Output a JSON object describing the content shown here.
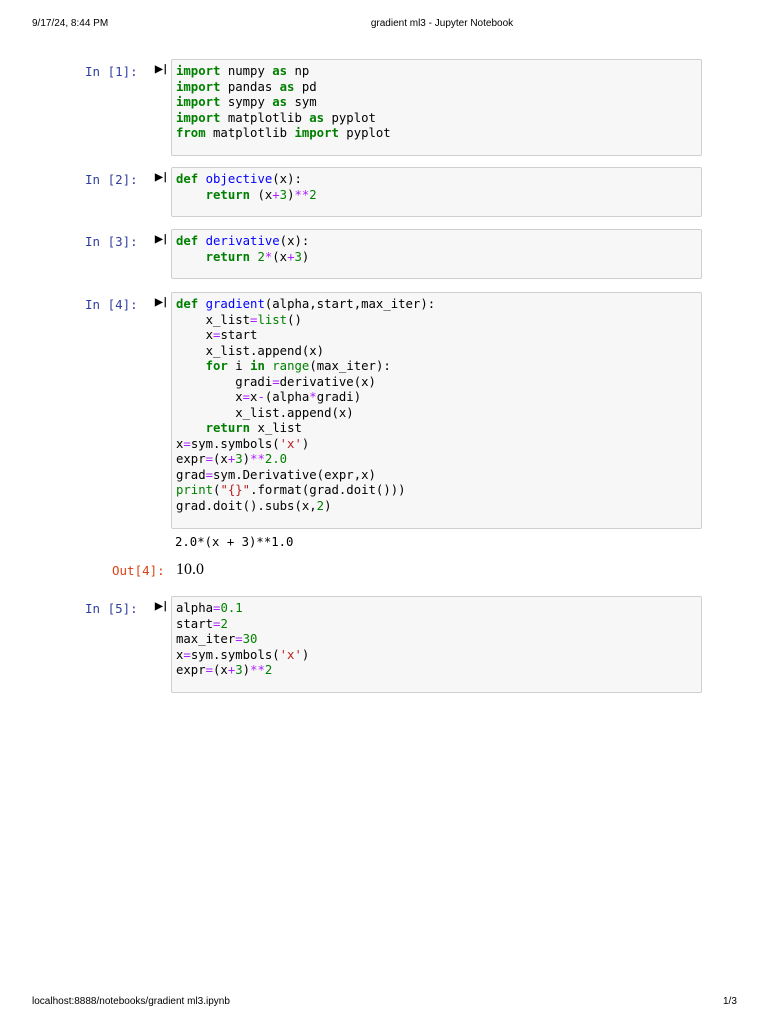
{
  "header": {
    "datetime": "9/17/24, 8:44 PM",
    "title": "gradient ml3 - Jupyter Notebook"
  },
  "footer": {
    "url": "localhost:8888/notebooks/gradient ml3.ipynb",
    "page": "1/3"
  },
  "cells": [
    {
      "prompt": "In [1]:",
      "lines": [
        [
          [
            "k",
            "import"
          ],
          [
            "p",
            " numpy "
          ],
          [
            "k",
            "as"
          ],
          [
            "p",
            " np"
          ]
        ],
        [
          [
            "k",
            "import"
          ],
          [
            "p",
            " pandas "
          ],
          [
            "k",
            "as"
          ],
          [
            "p",
            " pd"
          ]
        ],
        [
          [
            "k",
            "import"
          ],
          [
            "p",
            " sympy "
          ],
          [
            "k",
            "as"
          ],
          [
            "p",
            " sym"
          ]
        ],
        [
          [
            "k",
            "import"
          ],
          [
            "p",
            " matplotlib "
          ],
          [
            "k",
            "as"
          ],
          [
            "p",
            " pyplot"
          ]
        ],
        [
          [
            "k",
            "from"
          ],
          [
            "p",
            " matplotlib "
          ],
          [
            "k",
            "import"
          ],
          [
            "p",
            " pyplot"
          ]
        ]
      ]
    },
    {
      "prompt": "In [2]:",
      "lines": [
        [
          [
            "k",
            "def"
          ],
          [
            "p",
            " "
          ],
          [
            "f",
            "objective"
          ],
          [
            "p",
            "(x):"
          ]
        ],
        [
          [
            "p",
            "    "
          ],
          [
            "k",
            "return"
          ],
          [
            "p",
            " (x"
          ],
          [
            "o",
            "+"
          ],
          [
            "n",
            "3"
          ],
          [
            "p",
            ")"
          ],
          [
            "o",
            "**"
          ],
          [
            "n",
            "2"
          ]
        ]
      ]
    },
    {
      "prompt": "In [3]:",
      "lines": [
        [
          [
            "k",
            "def"
          ],
          [
            "p",
            " "
          ],
          [
            "f",
            "derivative"
          ],
          [
            "p",
            "(x):"
          ]
        ],
        [
          [
            "p",
            "    "
          ],
          [
            "k",
            "return"
          ],
          [
            "p",
            " "
          ],
          [
            "n",
            "2"
          ],
          [
            "o",
            "*"
          ],
          [
            "p",
            "(x"
          ],
          [
            "o",
            "+"
          ],
          [
            "n",
            "3"
          ],
          [
            "p",
            ")"
          ]
        ]
      ]
    },
    {
      "prompt": "In [4]:",
      "lines": [
        [
          [
            "k",
            "def"
          ],
          [
            "p",
            " "
          ],
          [
            "f",
            "gradient"
          ],
          [
            "p",
            "(alpha,start,max_iter):"
          ]
        ],
        [
          [
            "p",
            "    x_list"
          ],
          [
            "o",
            "="
          ],
          [
            "b",
            "list"
          ],
          [
            "p",
            "()"
          ]
        ],
        [
          [
            "p",
            "    x"
          ],
          [
            "o",
            "="
          ],
          [
            "p",
            "start"
          ]
        ],
        [
          [
            "p",
            "    x_list.append(x)"
          ]
        ],
        [
          [
            "p",
            "    "
          ],
          [
            "k",
            "for"
          ],
          [
            "p",
            " i "
          ],
          [
            "k",
            "in"
          ],
          [
            "p",
            " "
          ],
          [
            "b",
            "range"
          ],
          [
            "p",
            "(max_iter):"
          ]
        ],
        [
          [
            "p",
            "        gradi"
          ],
          [
            "o",
            "="
          ],
          [
            "p",
            "derivative(x)"
          ]
        ],
        [
          [
            "p",
            "        x"
          ],
          [
            "o",
            "="
          ],
          [
            "p",
            "x"
          ],
          [
            "o",
            "-"
          ],
          [
            "p",
            "(alpha"
          ],
          [
            "o",
            "*"
          ],
          [
            "p",
            "gradi)"
          ]
        ],
        [
          [
            "p",
            "        x_list.append(x)"
          ]
        ],
        [
          [
            "p",
            "    "
          ],
          [
            "k",
            "return"
          ],
          [
            "p",
            " x_list"
          ]
        ],
        [
          [
            "p",
            "x"
          ],
          [
            "o",
            "="
          ],
          [
            "p",
            "sym.symbols("
          ],
          [
            "s",
            "'x'"
          ],
          [
            "p",
            ")"
          ]
        ],
        [
          [
            "p",
            "expr"
          ],
          [
            "o",
            "="
          ],
          [
            "p",
            "(x"
          ],
          [
            "o",
            "+"
          ],
          [
            "n",
            "3"
          ],
          [
            "p",
            ")"
          ],
          [
            "o",
            "**"
          ],
          [
            "n",
            "2.0"
          ]
        ],
        [
          [
            "p",
            "grad"
          ],
          [
            "o",
            "="
          ],
          [
            "p",
            "sym.Derivative(expr,x)"
          ]
        ],
        [
          [
            "b",
            "print"
          ],
          [
            "p",
            "("
          ],
          [
            "s",
            "\"{}\""
          ],
          [
            "p",
            ".format(grad.doit()))"
          ]
        ],
        [
          [
            "p",
            "grad.doit().subs(x,"
          ],
          [
            "n",
            "2"
          ],
          [
            "p",
            ")"
          ]
        ]
      ],
      "stdout": "2.0*(x + 3)**1.0",
      "out_prompt": "Out[4]:",
      "result": "10.0"
    },
    {
      "prompt": "In [5]:",
      "lines": [
        [
          [
            "p",
            "alpha"
          ],
          [
            "o",
            "="
          ],
          [
            "n",
            "0.1"
          ]
        ],
        [
          [
            "p",
            "start"
          ],
          [
            "o",
            "="
          ],
          [
            "n",
            "2"
          ]
        ],
        [
          [
            "p",
            "max_iter"
          ],
          [
            "o",
            "="
          ],
          [
            "n",
            "30"
          ]
        ],
        [
          [
            "p",
            "x"
          ],
          [
            "o",
            "="
          ],
          [
            "p",
            "sym.symbols("
          ],
          [
            "s",
            "'x'"
          ],
          [
            "p",
            ")"
          ]
        ],
        [
          [
            "p",
            "expr"
          ],
          [
            "o",
            "="
          ],
          [
            "p",
            "(x"
          ],
          [
            "o",
            "+"
          ],
          [
            "n",
            "3"
          ],
          [
            "p",
            ")"
          ],
          [
            "o",
            "**"
          ],
          [
            "n",
            "2"
          ]
        ]
      ]
    }
  ]
}
